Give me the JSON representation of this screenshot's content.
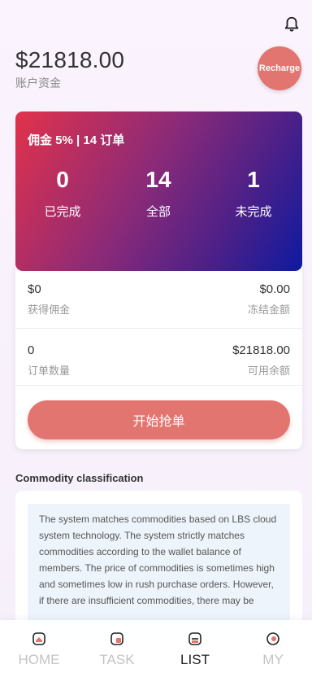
{
  "balance": {
    "amount": "$21818.00",
    "label": "账户资金"
  },
  "recharge_label": "Recharge",
  "stats": {
    "title": "佣金 5% | 14 订单",
    "completed": {
      "value": "0",
      "label": "已完成"
    },
    "total": {
      "value": "14",
      "label": "全部"
    },
    "pending": {
      "value": "1",
      "label": "未完成"
    }
  },
  "info": {
    "commission": {
      "value": "$0",
      "label": "获得佣金"
    },
    "frozen": {
      "value": "$0.00",
      "label": "冻结金额"
    },
    "orders": {
      "value": "0",
      "label": "订单数量"
    },
    "available": {
      "value": "$21818.00",
      "label": "可用余额"
    },
    "start_button": "开始抢单"
  },
  "section_title": "Commodity classification",
  "description": "The system matches commodities based on LBS cloud system technology. The system strictly matches commodities according to the wallet balance of members. The price of commodities is sometimes high and sometimes low in rush purchase orders. However, if there are insufficient commodities, there may be",
  "nav": [
    {
      "label": "HOME",
      "icon": "home-icon"
    },
    {
      "label": "TASK",
      "icon": "task-icon"
    },
    {
      "label": "LIST",
      "icon": "list-icon",
      "active": true
    },
    {
      "label": "MY",
      "icon": "profile-icon"
    }
  ],
  "colors": {
    "accent": "#e2756f",
    "card_gradient_start": "#e2324b",
    "card_gradient_end": "#0d1aa0"
  }
}
